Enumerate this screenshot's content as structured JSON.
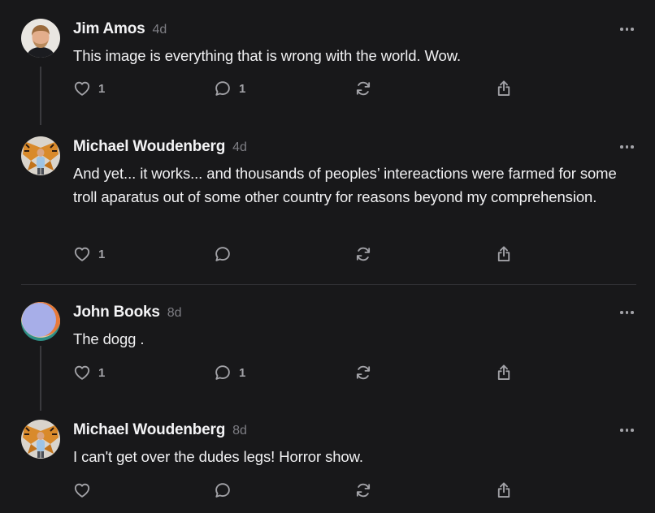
{
  "posts": [
    {
      "author": "Jim Amos",
      "time": "4d",
      "text": "This image is everything that is wrong with the world. Wow.",
      "likes": "1",
      "replies": "1",
      "avatar_icon": "man-portrait-avatar"
    },
    {
      "author": "Michael Woudenberg",
      "time": "4d",
      "text": "And yet... it works... and thousands of peoples’ intereactions were farmed for some troll aparatus out of some other country for reasons beyond my comprehension.",
      "likes": "1",
      "replies": "",
      "avatar_icon": "butterfly-wings-avatar"
    },
    {
      "author": "John Books",
      "time": "8d",
      "text": "The dogg .",
      "likes": "1",
      "replies": "1",
      "avatar_icon": "gradient-circle-avatar"
    },
    {
      "author": "Michael Woudenberg",
      "time": "8d",
      "text": "I can't get over the dudes legs! Horror show.",
      "likes": "",
      "replies": "",
      "avatar_icon": "butterfly-wings-avatar"
    }
  ],
  "icons": {
    "like": "heart-icon",
    "reply": "comment-bubble-icon",
    "restack": "restack-icon",
    "share": "share-icon",
    "more": "more-options-icon"
  },
  "colors": {
    "background": "#18181a",
    "text": "#f1f1f3",
    "muted": "#7e7e84",
    "icon": "#a3a3a8",
    "thread_line": "#3a3a3e"
  }
}
